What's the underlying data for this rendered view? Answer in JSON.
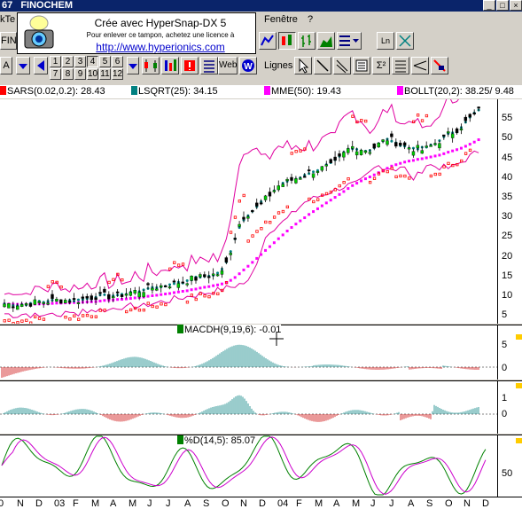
{
  "window": {
    "title": "FINOCHEM",
    "title_prefix": "67"
  },
  "menu": {
    "left_fragment": "kTe",
    "fenetre": "Fenêtre",
    "help": "?"
  },
  "stamp": {
    "line1": "Crée avec HyperSnap-DX 5",
    "line2": "Pour enlever ce tampon, achetez une licence à",
    "line3": "http://www.hyperionics.com"
  },
  "toolbar": {
    "fin_label": "FIN",
    "a_label": "A",
    "numbers": [
      "1",
      "2",
      "3",
      "4",
      "5",
      "6",
      "7",
      "8",
      "9",
      "10",
      "11",
      "12"
    ],
    "web_label": "Web",
    "web_icon_letter": "W",
    "lignes_label": "Lignes",
    "ln_label": "Ln"
  },
  "legend": {
    "sar": "SARS(0.02,0.2): 28.43",
    "lsqrt": "LSQRT(25): 34.15",
    "mme": "MME(50): 19.43",
    "bollt": "BOLLT(20,2): 38.25/  9.48",
    "colors": {
      "sar": "#ff0000",
      "lsqrt": "#008080",
      "mme": "#ff00ff",
      "bollt": "#ff00ff"
    }
  },
  "price_axis": [
    "55",
    "50",
    "45",
    "40",
    "35",
    "30",
    "25",
    "20",
    "15",
    "10",
    "5"
  ],
  "macd": {
    "label": "MACDH(9,19,6): -0.01",
    "axis": [
      "5",
      "0"
    ]
  },
  "osc": {
    "axis": [
      "1",
      "0"
    ]
  },
  "stoch": {
    "label": "%D(14,5): 85.07",
    "axis": [
      "50"
    ]
  },
  "xaxis": [
    "0",
    "N",
    "D",
    "03",
    "F",
    "M",
    "A",
    "M",
    "J",
    "J",
    "A",
    "S",
    "O",
    "N",
    "D",
    "04",
    "F",
    "M",
    "A",
    "M",
    "J",
    "J",
    "A",
    "S",
    "O",
    "N",
    "D"
  ],
  "chart_data": {
    "type": "candlestick",
    "title": "FINOCHEM",
    "y_range": [
      3,
      60
    ],
    "months": [
      "O",
      "N",
      "D",
      "03",
      "F",
      "M",
      "A",
      "M",
      "J",
      "J",
      "A",
      "S",
      "O",
      "N",
      "D",
      "04",
      "F",
      "M",
      "A",
      "M",
      "J",
      "J",
      "A",
      "S",
      "O",
      "N",
      "D"
    ],
    "close_by_month": [
      8,
      8,
      8.5,
      9,
      9,
      10,
      10,
      11,
      12,
      13,
      14,
      15,
      16,
      30,
      33,
      38,
      40,
      42,
      43,
      48,
      47,
      50,
      48,
      47,
      50,
      53,
      57
    ],
    "series": [
      {
        "name": "SARS(0.02,0.2)",
        "last": 28.43
      },
      {
        "name": "LSQRT(25)",
        "last": 34.15
      },
      {
        "name": "MME(50)",
        "last": 19.43
      },
      {
        "name": "BOLLT(20,2)",
        "last": "38.25/ 9.48"
      },
      {
        "name": "MACDH(9,19,6)",
        "last": -0.01
      },
      {
        "name": "%D(14,5)",
        "last": 85.07
      }
    ]
  }
}
